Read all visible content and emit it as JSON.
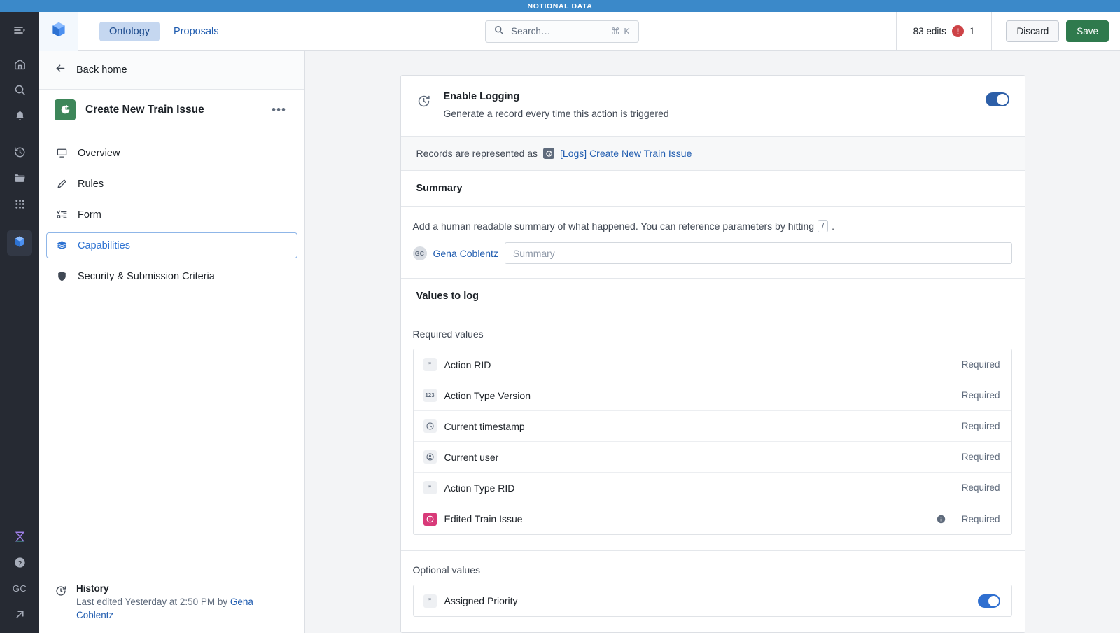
{
  "banner": {
    "label": "NOTIONAL DATA"
  },
  "rail": {
    "collapse_icon": "sidebar-toggle-icon",
    "items": [
      {
        "name": "home-icon"
      },
      {
        "name": "search-icon"
      },
      {
        "name": "notifications-icon"
      },
      {
        "name": "history-icon"
      },
      {
        "name": "folder-icon"
      },
      {
        "name": "apps-grid-icon"
      }
    ],
    "active_item": "ontology-cube-icon",
    "bottom": [
      {
        "name": "hourglass-icon"
      },
      {
        "name": "help-icon"
      },
      {
        "name": "user-initials",
        "label": "GC"
      },
      {
        "name": "external-link-icon"
      }
    ]
  },
  "topbar": {
    "logo": "ontology-cube-logo",
    "tabs": [
      {
        "label": "Ontology",
        "active": true
      },
      {
        "label": "Proposals",
        "active": false
      }
    ],
    "search": {
      "placeholder": "Search…",
      "shortcut": "⌘ K"
    },
    "edits_label": "83 edits",
    "error_count": "1",
    "discard_label": "Discard",
    "save_label": "Save",
    "save_color": "#2f7a4d"
  },
  "leftpanel": {
    "back_label": "Back home",
    "title": "Create New Train Issue",
    "overflow_label": "•••",
    "menu": [
      {
        "label": "Overview",
        "icon": "monitor-icon",
        "active": false
      },
      {
        "label": "Rules",
        "icon": "pencil-icon",
        "active": false
      },
      {
        "label": "Form",
        "icon": "form-checklist-icon",
        "active": false
      },
      {
        "label": "Capabilities",
        "icon": "layers-icon",
        "active": true
      },
      {
        "label": "Security & Submission Criteria",
        "icon": "shield-icon",
        "active": false
      }
    ],
    "history": {
      "title": "History",
      "subtitle_prefix": "Last edited Yesterday at 2:50 PM by ",
      "author": "Gena Coblentz"
    }
  },
  "main": {
    "enable_logging": {
      "title": "Enable Logging",
      "subtitle": "Generate a record every time this action is triggered",
      "toggle_on": true
    },
    "records_row": {
      "prefix": "Records are represented as",
      "link": "[Logs] Create New Train Issue"
    },
    "summary": {
      "heading": "Summary",
      "description_before": "Add a human readable summary of what happened. You can reference parameters by hitting",
      "key_hint": "/",
      "description_after": ".",
      "avatar_initials": "GC",
      "user": "Gena Coblentz",
      "input_placeholder": "Summary",
      "input_value": ""
    },
    "values_to_log": {
      "heading": "Values to log",
      "required_label": "Required values",
      "required_items": [
        {
          "name": "Action RID",
          "type_icon": "string-type-icon",
          "type_glyph": "”",
          "status": "Required",
          "has_info": false
        },
        {
          "name": "Action Type Version",
          "type_icon": "number-type-icon",
          "type_glyph": "123",
          "status": "Required",
          "has_info": false
        },
        {
          "name": "Current timestamp",
          "type_icon": "timestamp-type-icon",
          "type_glyph": "clock",
          "status": "Required",
          "has_info": false
        },
        {
          "name": "Current user",
          "type_icon": "user-type-icon",
          "type_glyph": "user",
          "status": "Required",
          "has_info": false
        },
        {
          "name": "Action Type RID",
          "type_icon": "string-type-icon",
          "type_glyph": "”",
          "status": "Required",
          "has_info": false
        },
        {
          "name": "Edited Train Issue",
          "type_icon": "object-type-icon",
          "type_glyph": "object",
          "status": "Required",
          "has_info": true
        }
      ],
      "optional_label": "Optional values",
      "optional_items": [
        {
          "name": "Assigned Priority",
          "type_icon": "string-type-icon",
          "type_glyph": "”",
          "toggle_on": true
        }
      ]
    }
  }
}
